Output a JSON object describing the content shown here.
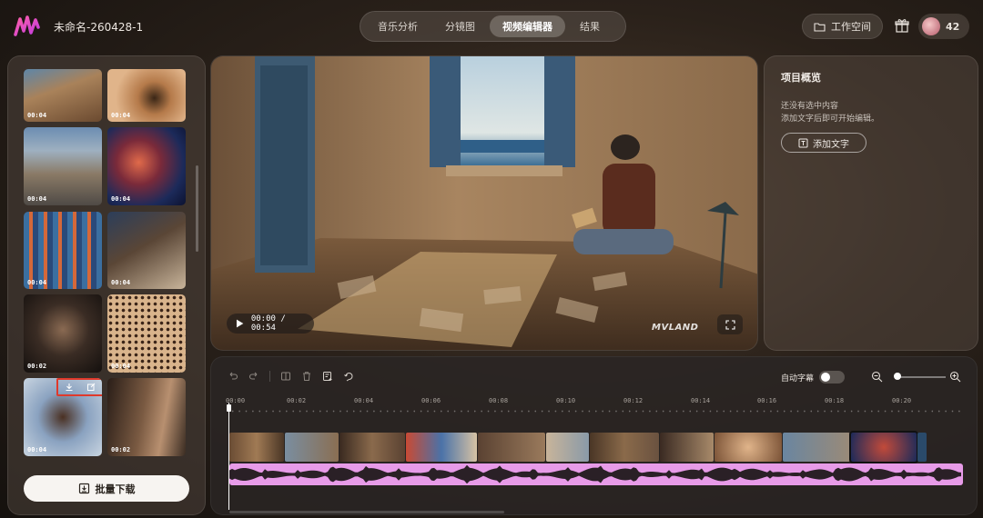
{
  "app": {
    "project_title": "未命名-260428-1",
    "tabs": [
      {
        "label": "音乐分析",
        "active": false
      },
      {
        "label": "分镜图",
        "active": false
      },
      {
        "label": "视频编辑器",
        "active": true
      },
      {
        "label": "结果",
        "active": false
      }
    ],
    "workspace_label": "工作空间",
    "credits": "42"
  },
  "media_panel": {
    "thumbnails": [
      {
        "duration": "00:04",
        "scene": "man-writing-at-table"
      },
      {
        "duration": "00:04",
        "scene": "eye-closeup"
      },
      {
        "duration": "00:04",
        "scene": "man-lying-on-ground"
      },
      {
        "duration": "00:04",
        "scene": "red-blue-portrait"
      },
      {
        "duration": "00:04",
        "scene": "figure-in-light-rays"
      },
      {
        "duration": "00:04",
        "scene": "man-with-cap-walking"
      },
      {
        "duration": "00:02",
        "scene": "dark-portrait"
      },
      {
        "duration": "00:04",
        "scene": "dotted-texture"
      },
      {
        "duration": "00:04",
        "scene": "man-with-headphones",
        "selected": true
      },
      {
        "duration": "00:02",
        "scene": "portrait-side"
      }
    ],
    "batch_download_label": "批量下载"
  },
  "preview": {
    "current_time": "00:00",
    "total_time": "00:54",
    "time_display": "00:00 / 00:54",
    "watermark": "MVLAND"
  },
  "overview": {
    "title": "项目概览",
    "empty_line1": "还没有选中内容",
    "empty_line2": "添加文字后即可开始编辑。",
    "add_text_label": "添加文字"
  },
  "timeline": {
    "auto_caption_label": "自动字幕",
    "auto_caption_on": false,
    "ticks": [
      "00:00",
      "00:02",
      "00:04",
      "00:06",
      "00:08",
      "00:10",
      "00:12",
      "00:14",
      "00:16",
      "00:18",
      "00:20"
    ],
    "clip_count": 14
  },
  "colors": {
    "accent": "#e79be8",
    "highlight_box": "#e0392b",
    "brand": "#f04b8f"
  }
}
